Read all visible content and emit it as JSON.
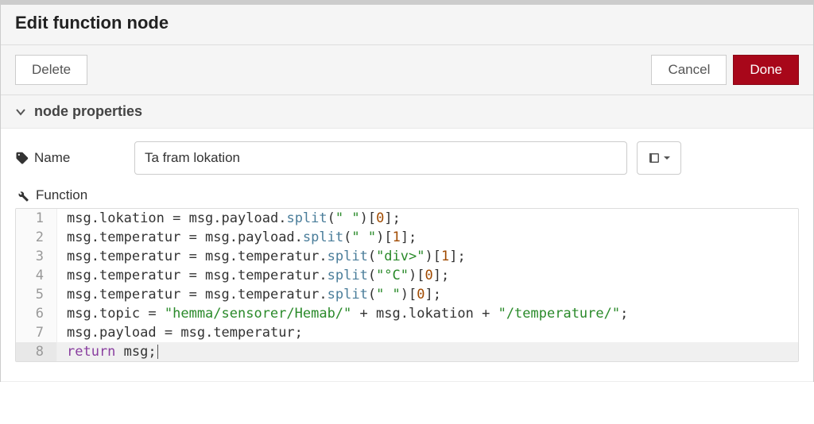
{
  "header": {
    "title": "Edit function node"
  },
  "actions": {
    "delete_label": "Delete",
    "cancel_label": "Cancel",
    "done_label": "Done"
  },
  "section": {
    "title": "node properties"
  },
  "name_field": {
    "label": "Name",
    "value": "Ta fram lokation"
  },
  "function_field": {
    "label": "Function"
  },
  "code": {
    "lines": [
      {
        "n": 1,
        "tokens": [
          {
            "t": "msg",
            "c": "id"
          },
          {
            "t": ".",
            "c": "op"
          },
          {
            "t": "lokation",
            "c": "prop"
          },
          {
            "t": " = ",
            "c": "op"
          },
          {
            "t": "msg",
            "c": "id"
          },
          {
            "t": ".",
            "c": "op"
          },
          {
            "t": "payload",
            "c": "prop"
          },
          {
            "t": ".",
            "c": "op"
          },
          {
            "t": "split",
            "c": "fn"
          },
          {
            "t": "(",
            "c": "op"
          },
          {
            "t": "\" \"",
            "c": "str"
          },
          {
            "t": ")[",
            "c": "op"
          },
          {
            "t": "0",
            "c": "num"
          },
          {
            "t": "];",
            "c": "op"
          }
        ]
      },
      {
        "n": 2,
        "tokens": [
          {
            "t": "msg",
            "c": "id"
          },
          {
            "t": ".",
            "c": "op"
          },
          {
            "t": "temperatur",
            "c": "prop"
          },
          {
            "t": " = ",
            "c": "op"
          },
          {
            "t": "msg",
            "c": "id"
          },
          {
            "t": ".",
            "c": "op"
          },
          {
            "t": "payload",
            "c": "prop"
          },
          {
            "t": ".",
            "c": "op"
          },
          {
            "t": "split",
            "c": "fn"
          },
          {
            "t": "(",
            "c": "op"
          },
          {
            "t": "\" \"",
            "c": "str"
          },
          {
            "t": ")[",
            "c": "op"
          },
          {
            "t": "1",
            "c": "num"
          },
          {
            "t": "];",
            "c": "op"
          }
        ]
      },
      {
        "n": 3,
        "tokens": [
          {
            "t": "msg",
            "c": "id"
          },
          {
            "t": ".",
            "c": "op"
          },
          {
            "t": "temperatur",
            "c": "prop"
          },
          {
            "t": " = ",
            "c": "op"
          },
          {
            "t": "msg",
            "c": "id"
          },
          {
            "t": ".",
            "c": "op"
          },
          {
            "t": "temperatur",
            "c": "prop"
          },
          {
            "t": ".",
            "c": "op"
          },
          {
            "t": "split",
            "c": "fn"
          },
          {
            "t": "(",
            "c": "op"
          },
          {
            "t": "\"div>\"",
            "c": "str"
          },
          {
            "t": ")[",
            "c": "op"
          },
          {
            "t": "1",
            "c": "num"
          },
          {
            "t": "];",
            "c": "op"
          }
        ]
      },
      {
        "n": 4,
        "tokens": [
          {
            "t": "msg",
            "c": "id"
          },
          {
            "t": ".",
            "c": "op"
          },
          {
            "t": "temperatur",
            "c": "prop"
          },
          {
            "t": " = ",
            "c": "op"
          },
          {
            "t": "msg",
            "c": "id"
          },
          {
            "t": ".",
            "c": "op"
          },
          {
            "t": "temperatur",
            "c": "prop"
          },
          {
            "t": ".",
            "c": "op"
          },
          {
            "t": "split",
            "c": "fn"
          },
          {
            "t": "(",
            "c": "op"
          },
          {
            "t": "\"°C\"",
            "c": "str"
          },
          {
            "t": ")[",
            "c": "op"
          },
          {
            "t": "0",
            "c": "num"
          },
          {
            "t": "];",
            "c": "op"
          }
        ]
      },
      {
        "n": 5,
        "tokens": [
          {
            "t": "msg",
            "c": "id"
          },
          {
            "t": ".",
            "c": "op"
          },
          {
            "t": "temperatur",
            "c": "prop"
          },
          {
            "t": " = ",
            "c": "op"
          },
          {
            "t": "msg",
            "c": "id"
          },
          {
            "t": ".",
            "c": "op"
          },
          {
            "t": "temperatur",
            "c": "prop"
          },
          {
            "t": ".",
            "c": "op"
          },
          {
            "t": "split",
            "c": "fn"
          },
          {
            "t": "(",
            "c": "op"
          },
          {
            "t": "\" \"",
            "c": "str"
          },
          {
            "t": ")[",
            "c": "op"
          },
          {
            "t": "0",
            "c": "num"
          },
          {
            "t": "];",
            "c": "op"
          }
        ]
      },
      {
        "n": 6,
        "tokens": [
          {
            "t": "msg",
            "c": "id"
          },
          {
            "t": ".",
            "c": "op"
          },
          {
            "t": "topic",
            "c": "prop"
          },
          {
            "t": " = ",
            "c": "op"
          },
          {
            "t": "\"hemma/sensorer/Hemab/\"",
            "c": "str"
          },
          {
            "t": " + ",
            "c": "op"
          },
          {
            "t": "msg",
            "c": "id"
          },
          {
            "t": ".",
            "c": "op"
          },
          {
            "t": "lokation",
            "c": "prop"
          },
          {
            "t": " + ",
            "c": "op"
          },
          {
            "t": "\"/temperature/\"",
            "c": "str"
          },
          {
            "t": ";",
            "c": "op"
          }
        ]
      },
      {
        "n": 7,
        "tokens": [
          {
            "t": "msg",
            "c": "id"
          },
          {
            "t": ".",
            "c": "op"
          },
          {
            "t": "payload",
            "c": "prop"
          },
          {
            "t": " = ",
            "c": "op"
          },
          {
            "t": "msg",
            "c": "id"
          },
          {
            "t": ".",
            "c": "op"
          },
          {
            "t": "temperatur",
            "c": "prop"
          },
          {
            "t": ";",
            "c": "op"
          }
        ]
      },
      {
        "n": 8,
        "active": true,
        "tokens": [
          {
            "t": "return",
            "c": "kw"
          },
          {
            "t": " ",
            "c": "op"
          },
          {
            "t": "msg",
            "c": "id"
          },
          {
            "t": ";",
            "c": "op"
          }
        ]
      }
    ]
  }
}
